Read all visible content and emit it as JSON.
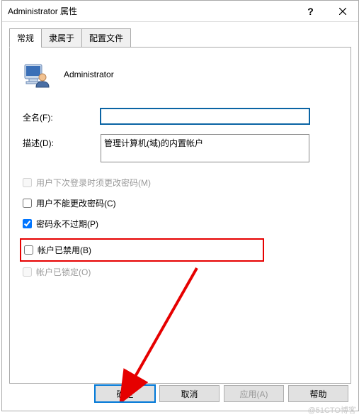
{
  "titlebar": {
    "title": "Administrator 属性",
    "help": "?",
    "close": "✕"
  },
  "tabs": {
    "general": "常规",
    "memberof": "隶属于",
    "profile": "配置文件"
  },
  "general": {
    "username": "Administrator",
    "fullname_label": "全名(F):",
    "fullname_value": "",
    "description_label": "描述(D):",
    "description_value": "管理计算机(域)的内置帐户"
  },
  "checkboxes": {
    "mustchange": "用户下次登录时须更改密码(M)",
    "mustchange_checked": false,
    "cantchange": "用户不能更改密码(C)",
    "cantchange_checked": false,
    "neverexpire": "密码永不过期(P)",
    "neverexpire_checked": true,
    "disabled": "帐户已禁用(B)",
    "disabled_checked": false,
    "locked": "帐户已锁定(O)",
    "locked_checked": false
  },
  "buttons": {
    "ok": "确定",
    "cancel": "取消",
    "apply": "应用(A)",
    "help": "帮助"
  },
  "watermark": "@51CTO博客"
}
